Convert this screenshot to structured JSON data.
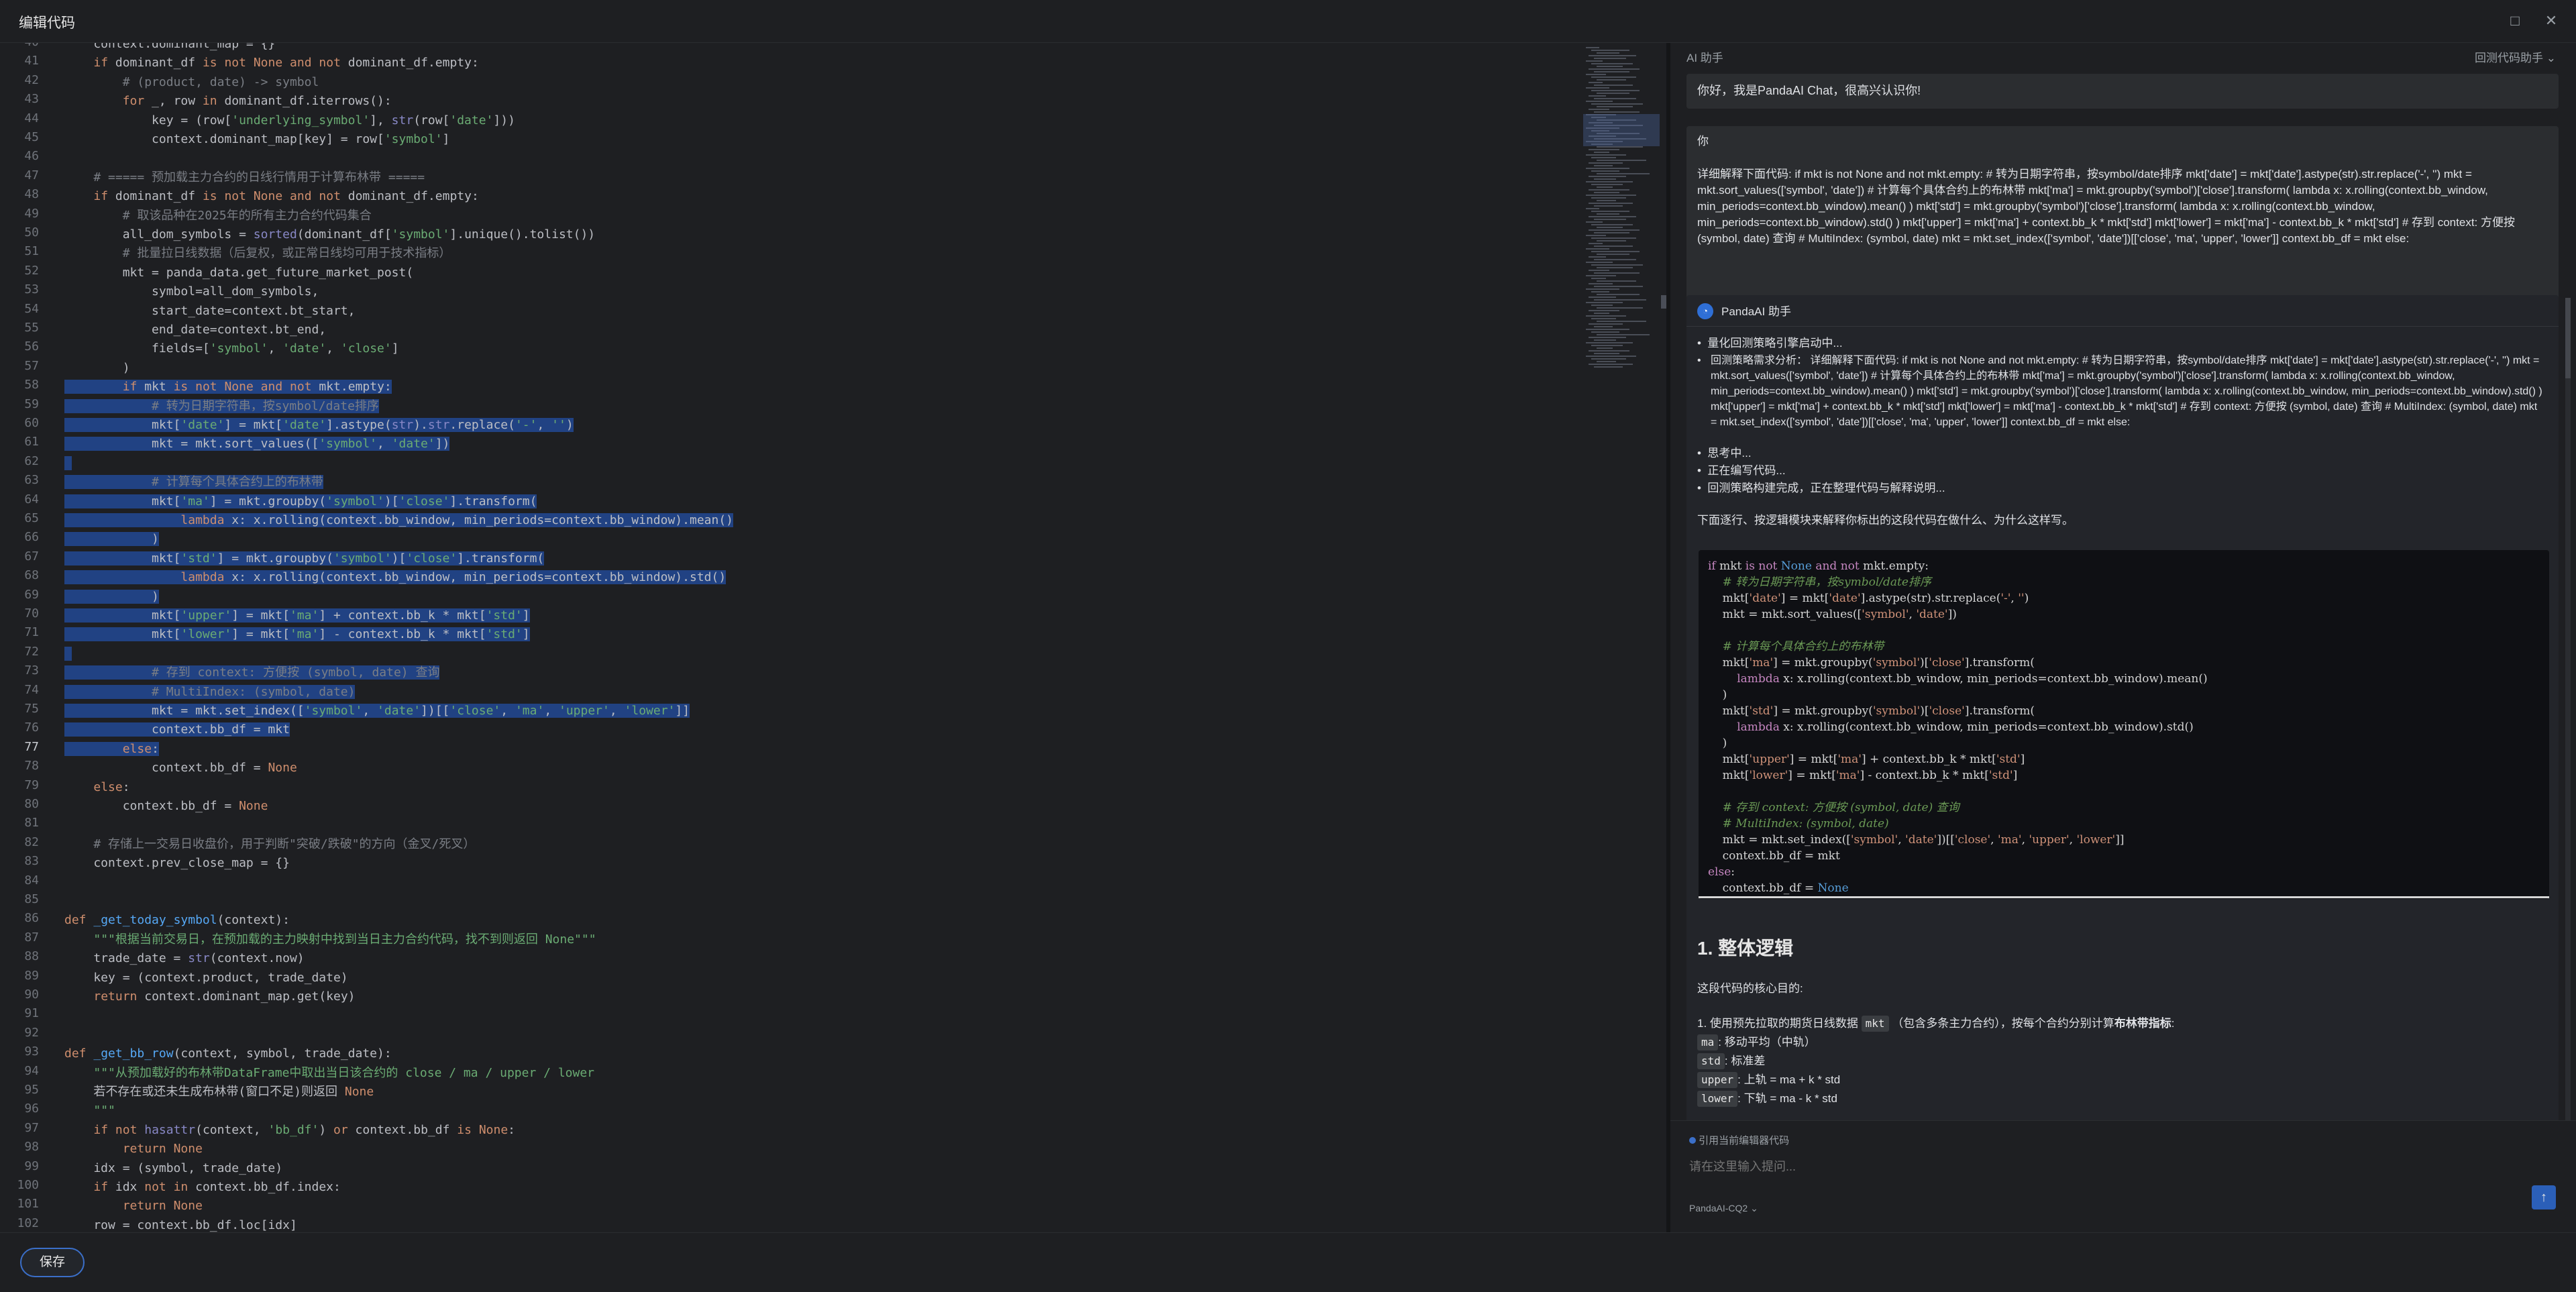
{
  "window": {
    "title": "编辑代码"
  },
  "editor": {
    "first_line": 40,
    "current_line": 77,
    "lines": [
      "    context.dominant_map = {}",
      "    if dominant_df is not None and not dominant_df.empty:",
      "        # (product, date) -> symbol",
      "        for _, row in dominant_df.iterrows():",
      "            key = (row['underlying_symbol'], str(row['date']))",
      "            context.dominant_map[key] = row['symbol']",
      "",
      "    # ===== 预加载主力合约的日线行情用于计算布林带 =====",
      "    if dominant_df is not None and not dominant_df.empty:",
      "        # 取该品种在2025年的所有主力合约代码集合",
      "        all_dom_symbols = sorted(dominant_df['symbol'].unique().tolist())",
      "        # 批量拉日线数据（后复权，或正常日线均可用于技术指标）",
      "        mkt = panda_data.get_future_market_post(",
      "            symbol=all_dom_symbols,",
      "            start_date=context.bt_start,",
      "            end_date=context.bt_end,",
      "            fields=['symbol', 'date', 'close']",
      "        )",
      "        if mkt is not None and not mkt.empty:",
      "            # 转为日期字符串，按symbol/date排序",
      "            mkt['date'] = mkt['date'].astype(str).str.replace('-', '')",
      "            mkt = mkt.sort_values(['symbol', 'date'])",
      "",
      "            # 计算每个具体合约上的布林带",
      "            mkt['ma'] = mkt.groupby('symbol')['close'].transform(",
      "                lambda x: x.rolling(context.bb_window, min_periods=context.bb_window).mean()",
      "            )",
      "            mkt['std'] = mkt.groupby('symbol')['close'].transform(",
      "                lambda x: x.rolling(context.bb_window, min_periods=context.bb_window).std()",
      "            )",
      "            mkt['upper'] = mkt['ma'] + context.bb_k * mkt['std']",
      "            mkt['lower'] = mkt['ma'] - context.bb_k * mkt['std']",
      "",
      "            # 存到 context: 方便按 (symbol, date) 查询",
      "            # MultiIndex: (symbol, date)",
      "            mkt = mkt.set_index(['symbol', 'date'])[['close', 'ma', 'upper', 'lower']]",
      "            context.bb_df = mkt",
      "        else:",
      "            context.bb_df = None",
      "    else:",
      "        context.bb_df = None",
      "",
      "    # 存储上一交易日收盘价，用于判断\"突破/跌破\"的方向（金叉/死叉）",
      "    context.prev_close_map = {}",
      "",
      "",
      "def _get_today_symbol(context):",
      "    \"\"\"根据当前交易日，在预加载的主力映射中找到当日主力合约代码，找不到则返回 None\"\"\"",
      "    trade_date = str(context.now)",
      "    key = (context.product, trade_date)",
      "    return context.dominant_map.get(key)",
      "",
      "",
      "def _get_bb_row(context, symbol, trade_date):",
      "    \"\"\"从预加载好的布林带DataFrame中取出当日该合约的 close / ma / upper / lower",
      "    若不存在或还未生成布林带(窗口不足)则返回 None",
      "    \"\"\"",
      "    if not hasattr(context, 'bb_df') or context.bb_df is None:",
      "        return None",
      "    idx = (symbol, trade_date)",
      "    if idx not in context.bb_df.index:",
      "        return None",
      "    row = context.bb_df.loc[idx]"
    ]
  },
  "ai": {
    "header": "AI 助手",
    "mode": "回测代码助手",
    "greeting": "你好，我是PandaAI Chat，很高兴认识你!",
    "user_label": "你",
    "user_message": "详细解释下面代码: if mkt is not None and not mkt.empty: # 转为日期字符串，按symbol/date排序 mkt['date'] = mkt['date'].astype(str).str.replace('-', '') mkt = mkt.sort_values(['symbol', 'date']) # 计算每个具体合约上的布林带 mkt['ma'] = mkt.groupby('symbol')['close'].transform( lambda x: x.rolling(context.bb_window, min_periods=context.bb_window).mean() ) mkt['std'] = mkt.groupby('symbol')['close'].transform( lambda x: x.rolling(context.bb_window, min_periods=context.bb_window).std() ) mkt['upper'] = mkt['ma'] + context.bb_k * mkt['std'] mkt['lower'] = mkt['ma'] - context.bb_k * mkt['std'] # 存到 context: 方便按 (symbol, date) 查询 # MultiIndex: (symbol, date) mkt = mkt.set_index(['symbol', 'date'])[['close', 'ma', 'upper', 'lower']] context.bb_df = mkt else:",
    "assistant_label": "PandaAI 助手",
    "status_items": [
      "量化回测策略引擎启动中...",
      "回测策略需求分析：  详细解释下面代码: if mkt is not None and not mkt.empty: # 转为日期字符串，按symbol/date排序 mkt['date'] = mkt['date'].astype(str).str.replace('-', '') mkt = mkt.sort_values(['symbol', 'date']) # 计算每个具体合约上的布林带 mkt['ma'] = mkt.groupby('symbol')['close'].transform( lambda x: x.rolling(context.bb_window, min_periods=context.bb_window).mean() ) mkt['std'] = mkt.groupby('symbol')['close'].transform( lambda x: x.rolling(context.bb_window, min_periods=context.bb_window).std() ) mkt['upper'] = mkt['ma'] + context.bb_k * mkt['std'] mkt['lower'] = mkt['ma'] - context.bb_k * mkt['std'] # 存到 context: 方便按 (symbol, date) 查询 # MultiIndex: (symbol, date) mkt = mkt.set_index(['symbol', 'date'])[['close', 'ma', 'upper', 'lower']] context.bb_df = mkt else:",
      "思考中...",
      "正在编写代码...",
      "回测策略构建完成，正在整理代码与解释说明..."
    ],
    "intro": "下面逐行、按逻辑模块来解释你标出的这段代码在做什么、为什么这样写。",
    "code_lines": [
      "if mkt is not None and not mkt.empty:",
      "    # 转为日期字符串，按symbol/date排序",
      "    mkt['date'] = mkt['date'].astype(str).str.replace('-', '')",
      "    mkt = mkt.sort_values(['symbol', 'date'])",
      "",
      "    # 计算每个具体合约上的布林带",
      "    mkt['ma'] = mkt.groupby('symbol')['close'].transform(",
      "        lambda x: x.rolling(context.bb_window, min_periods=context.bb_window).mean()",
      "    )",
      "    mkt['std'] = mkt.groupby('symbol')['close'].transform(",
      "        lambda x: x.rolling(context.bb_window, min_periods=context.bb_window).std()",
      "    )",
      "    mkt['upper'] = mkt['ma'] + context.bb_k * mkt['std']",
      "    mkt['lower'] = mkt['ma'] - context.bb_k * mkt['std']",
      "",
      "    # 存到 context: 方便按 (symbol, date) 查询",
      "    # MultiIndex: (symbol, date)",
      "    mkt = mkt.set_index(['symbol', 'date'])[['close', 'ma', 'upper', 'lower']]",
      "    context.bb_df = mkt",
      "else:",
      "    context.bb_df = None"
    ],
    "section_title": "1. 整体逻辑",
    "section_intro": "这段代码的核心目的:",
    "point1_prefix": "1. 使用预先拉取的期货日线数据",
    "point1_tag": "mkt",
    "point1_mid": "（包含多条主力合约），按每个合约分别计算",
    "point1_bold": "布林带指标",
    "point1_suffix": ":",
    "defs": [
      {
        "tag": "ma",
        "text": ": 移动平均（中轨）"
      },
      {
        "tag": "std",
        "text": ": 标准差"
      },
      {
        "tag": "upper",
        "text": ": 上轨 = ma + k * std"
      },
      {
        "tag": "lower",
        "text": ": 下轨 = ma - k * std"
      }
    ],
    "ref_label": "引用当前编辑器代码",
    "input_placeholder": "请在这里输入提问...",
    "model": "PandaAI-CQ2"
  },
  "footer": {
    "save_label": "保存"
  }
}
